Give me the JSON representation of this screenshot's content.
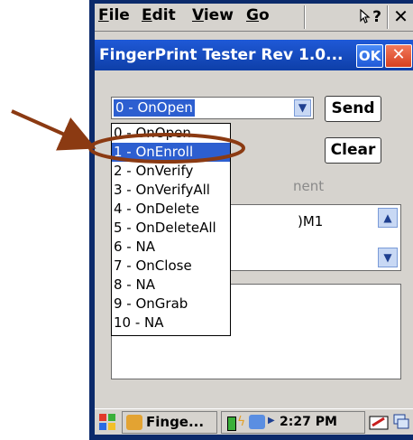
{
  "menu": {
    "file": {
      "first": "F",
      "rest": "ile"
    },
    "edit": {
      "first": "E",
      "rest": "dit"
    },
    "view": {
      "first": "V",
      "rest": "iew"
    },
    "go": {
      "first": "G",
      "rest": "o"
    },
    "help": "?",
    "close": "✕"
  },
  "titlebar": {
    "title": "FingerPrint Tester Rev 1.0...",
    "ok_label": "OK",
    "close_label": "✕"
  },
  "command_select": {
    "value": "0 - OnOpen",
    "options": [
      "0 - OnOpen",
      "1 - OnEnroll",
      "2 - OnVerify",
      "3 - OnVerifyAll",
      "4 - OnDelete",
      "5 - OnDeleteAll",
      "6 - NA",
      "7 - OnClose",
      "8 - NA",
      "9 - OnGrab",
      "10 - NA"
    ],
    "highlighted_index": 1
  },
  "buttons": {
    "send": "Send",
    "clear": "Clear"
  },
  "partial_text": {
    "hint": "nent",
    "port": ")M1"
  },
  "taskbar": {
    "app_label": "Finge...",
    "time": "2:27 PM"
  },
  "colors": {
    "highlight": "#2d5fd0",
    "titlebar": "#1f59d7",
    "annotation": "#8b3a12"
  }
}
